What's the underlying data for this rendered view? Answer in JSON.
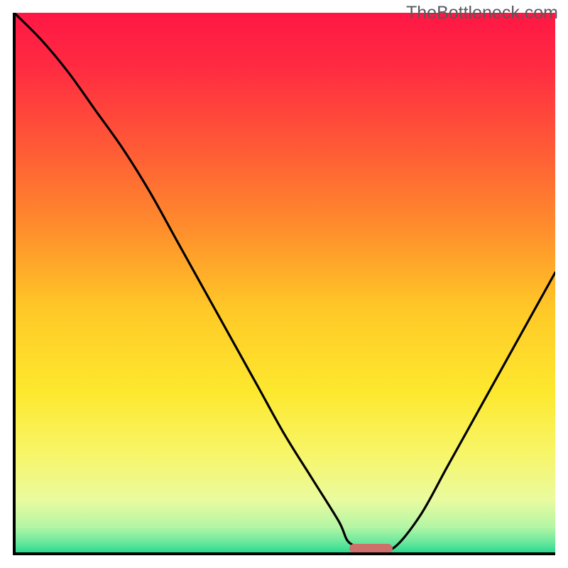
{
  "watermark": "TheBottleneck.com",
  "chart_data": {
    "type": "line",
    "title": "",
    "xlabel": "",
    "ylabel": "",
    "xlim": [
      0,
      100
    ],
    "ylim": [
      0,
      100
    ],
    "grid": false,
    "x": [
      0,
      5,
      10,
      15,
      20,
      25,
      30,
      35,
      40,
      45,
      50,
      55,
      60,
      62,
      66,
      70,
      75,
      80,
      85,
      90,
      95,
      100
    ],
    "values": [
      100,
      95,
      89,
      82,
      75,
      67,
      58,
      49,
      40,
      31,
      22,
      14,
      6,
      2,
      1,
      1,
      7,
      16,
      25,
      34,
      43,
      52
    ],
    "marker": {
      "x_start": 62,
      "x_end": 70,
      "y": 1,
      "color": "#cf6f6c"
    },
    "gradient_stops": [
      {
        "offset": 0.0,
        "color": "#ff1744"
      },
      {
        "offset": 0.1,
        "color": "#ff2b42"
      },
      {
        "offset": 0.25,
        "color": "#ff5a36"
      },
      {
        "offset": 0.4,
        "color": "#ff8e2c"
      },
      {
        "offset": 0.55,
        "color": "#ffc927"
      },
      {
        "offset": 0.7,
        "color": "#fde82e"
      },
      {
        "offset": 0.82,
        "color": "#f7f66b"
      },
      {
        "offset": 0.9,
        "color": "#eafb9f"
      },
      {
        "offset": 0.95,
        "color": "#b4f6a5"
      },
      {
        "offset": 0.98,
        "color": "#66e79c"
      },
      {
        "offset": 1.0,
        "color": "#22d88e"
      }
    ]
  }
}
